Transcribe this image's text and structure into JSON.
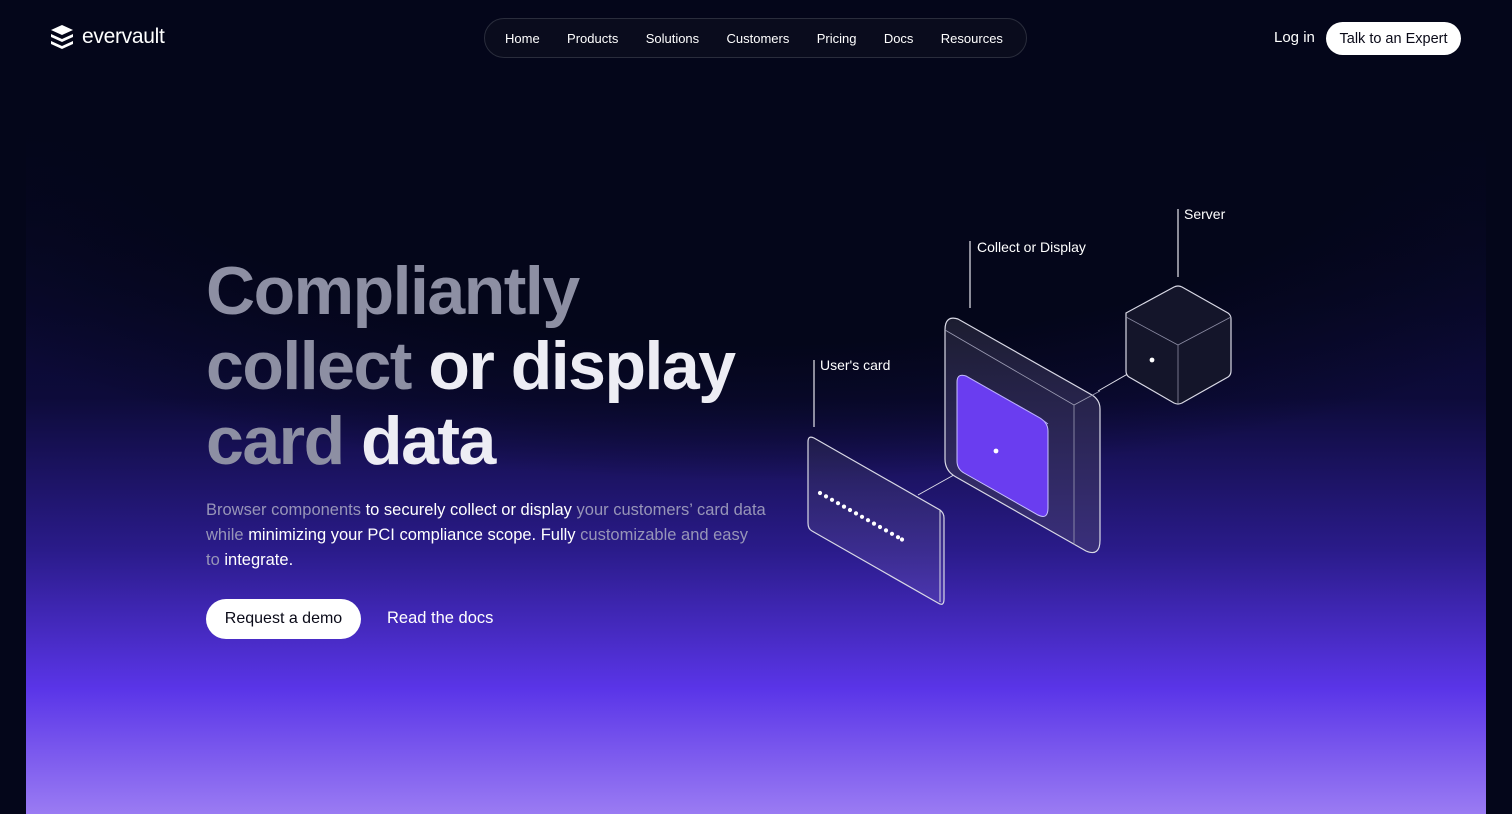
{
  "brand": {
    "name": "evervault",
    "logo_icon": "evervault-logo-icon"
  },
  "nav": {
    "items": [
      {
        "label": "Home"
      },
      {
        "label": "Products"
      },
      {
        "label": "Solutions"
      },
      {
        "label": "Customers"
      },
      {
        "label": "Pricing"
      },
      {
        "label": "Docs"
      },
      {
        "label": "Resources"
      }
    ],
    "login_label": "Log in",
    "cta_label": "Talk to an Expert"
  },
  "hero": {
    "title_line1": "Compliantly",
    "title_line2_dim": "collect",
    "title_line2_bright": "or display",
    "title_line3_dim": "card",
    "title_line3_bright": "data",
    "subtitle_parts": [
      {
        "text": "Browser components ",
        "tone": "dim"
      },
      {
        "text": "to securely collect or display ",
        "tone": "bright"
      },
      {
        "text": "your customers’ card data while ",
        "tone": "dim"
      },
      {
        "text": "minimizing your PCI compliance scope. Fully ",
        "tone": "bright"
      },
      {
        "text": "customizable and easy to ",
        "tone": "dim"
      },
      {
        "text": "integrate.",
        "tone": "bright"
      }
    ],
    "primary_button": "Request a demo",
    "secondary_link": "Read the docs"
  },
  "illustration": {
    "labels": {
      "card": "User's card",
      "collect": "Collect or Display",
      "server": "Server"
    },
    "accent_color": "#6a3df0",
    "background_gradient": [
      "#04061a",
      "#2a1b8a",
      "#5a35e8",
      "#9a7bf3"
    ]
  }
}
